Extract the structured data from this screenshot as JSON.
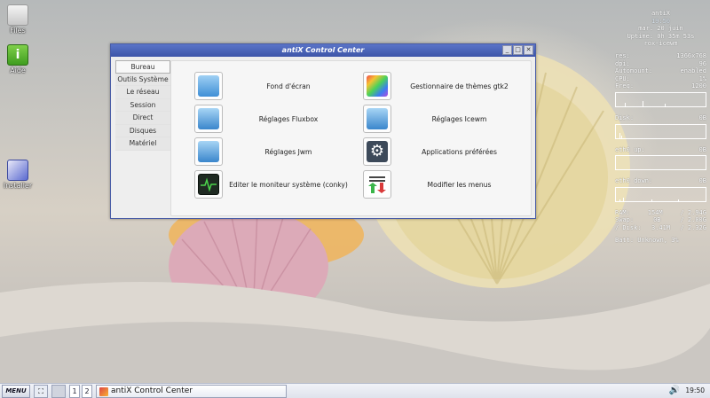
{
  "desktop": {
    "icons": [
      {
        "label": "Files",
        "icon": "folder-icon"
      },
      {
        "label": "Aide",
        "icon": "info-icon"
      },
      {
        "label": "Installer",
        "icon": "installer-icon"
      }
    ]
  },
  "conky": {
    "hostname": "antiX",
    "time": "19:50",
    "date": "mar. 20 juin",
    "uptime": "Uptime: 0h 35m 53s",
    "wm": "rox-icewm",
    "stats": [
      {
        "key": "res:",
        "value": "1366x768"
      },
      {
        "key": "dpi:",
        "value": "96"
      },
      {
        "key": "Automount:",
        "value": "enabled"
      },
      {
        "key": "CPU:",
        "value": "1%"
      },
      {
        "key": "Freq:",
        "value": "1200"
      }
    ],
    "disk": {
      "key": "Disk:",
      "value": "0B"
    },
    "eth0_up": {
      "key": "eth0 up:",
      "value": "0B"
    },
    "eth0_down": {
      "key": "eth0 down:",
      "value": "0B"
    },
    "memory": [
      {
        "key": "RAM:",
        "used": "154M",
        "total": "/ 2.94G"
      },
      {
        "key": "Swap:",
        "used": "0B",
        "total": "/ 2.00G"
      },
      {
        "key": "/ Disk:",
        "used": "3.41M",
        "total": "/ 2.32G"
      }
    ],
    "battery": "Batt: Unknown, 3%"
  },
  "window": {
    "title": "antiX Control Center",
    "controls": {
      "minimize": "_",
      "maximize": "□",
      "close": "✕"
    },
    "tabs": [
      "Bureau",
      "Outils Système",
      "Le réseau",
      "Session",
      "Direct",
      "Disques",
      "Matériel"
    ],
    "active_tab": "Bureau",
    "entries": [
      {
        "label": "Fond d'écran",
        "icon": "wallpaper-icon"
      },
      {
        "label": "Gestionnaire de thèmes gtk2",
        "icon": "theme-manager-icon"
      },
      {
        "label": "Réglages Fluxbox",
        "icon": "settings-brush-icon"
      },
      {
        "label": "Réglages Icewm",
        "icon": "settings-brush-icon"
      },
      {
        "label": "Réglages Jwm",
        "icon": "settings-brush-icon"
      },
      {
        "label": "Applications préférées",
        "icon": "gear-icon"
      },
      {
        "label": "Editer le moniteur système (conky)",
        "icon": "system-monitor-icon"
      },
      {
        "label": "Modifier les menus",
        "icon": "menu-editor-icon"
      }
    ]
  },
  "taskbar": {
    "menu_label": "MENU",
    "workspaces": [
      "1",
      "2"
    ],
    "task_label": "antiX Control Center",
    "clock": "19:50"
  },
  "colors": {
    "titlebar": "#4a63b8",
    "taskbar": "#e6e9f1",
    "window_bg": "#eeeeee"
  }
}
